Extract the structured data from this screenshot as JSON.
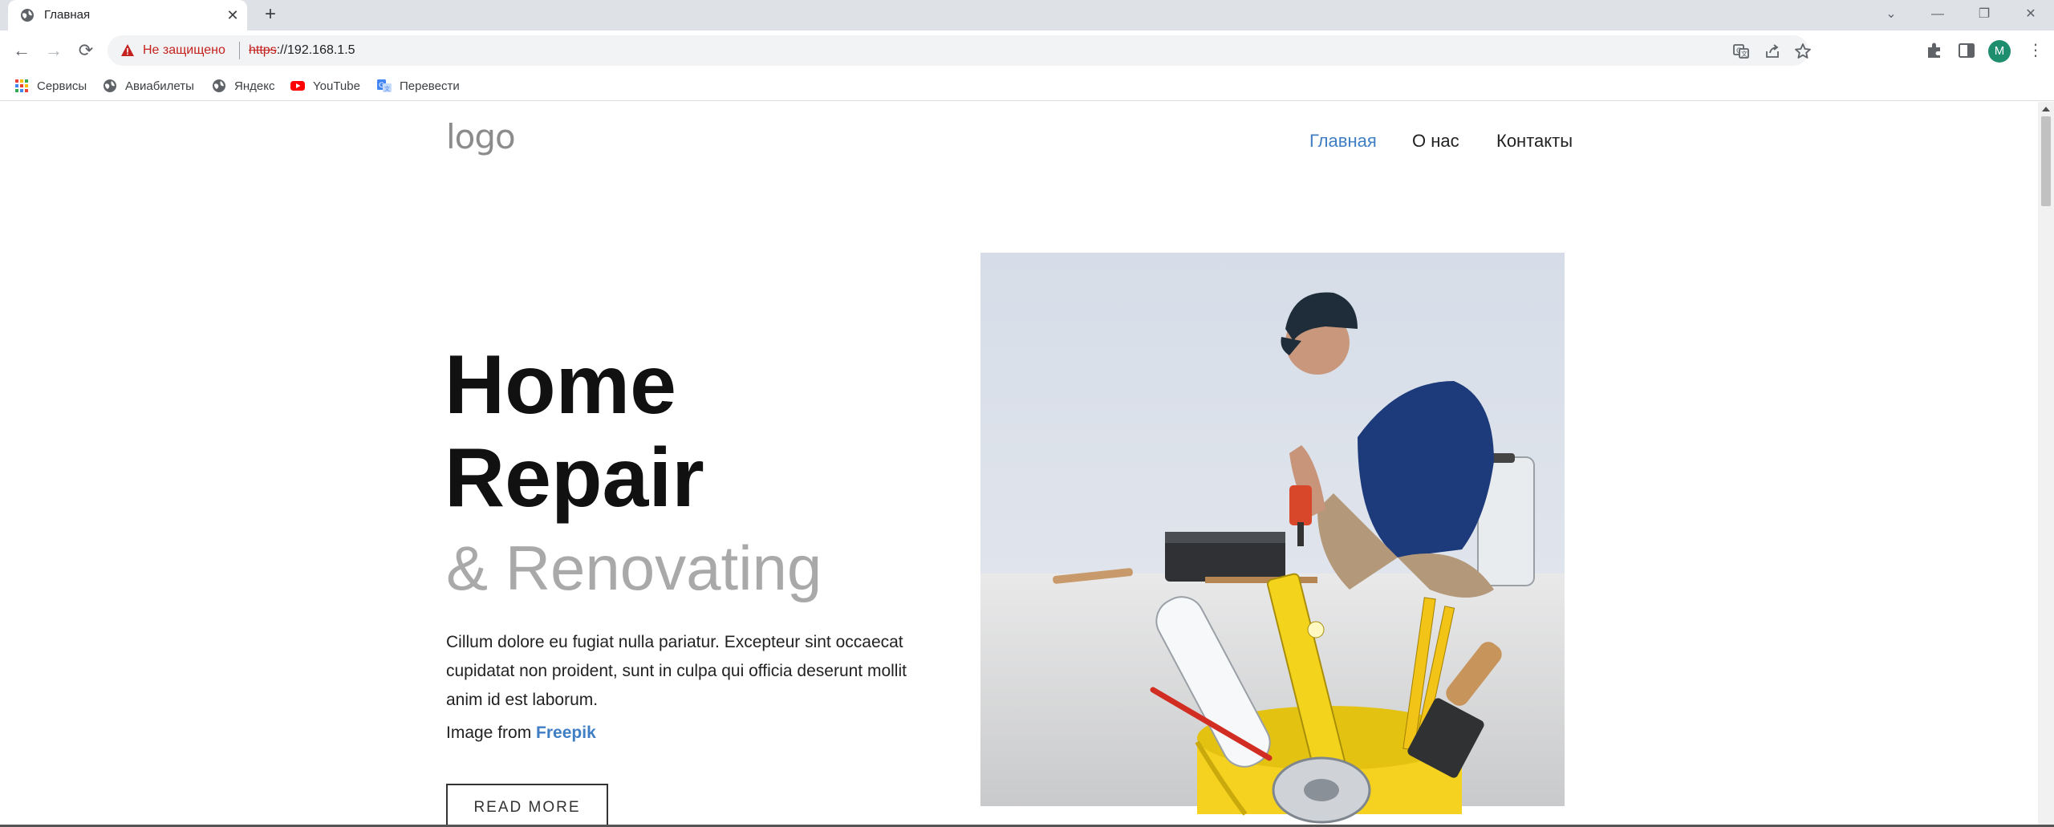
{
  "browser": {
    "tab": {
      "title": "Главная",
      "favicon": "globe-icon",
      "close_glyph": "✕"
    },
    "new_tab_glyph": "+",
    "window_controls": {
      "tab_search": "⌄",
      "minimize": "—",
      "restore": "❐",
      "close": "✕"
    },
    "toolbar": {
      "back": "←",
      "forward": "→",
      "reload": "⟳",
      "security_label": "Не защищено",
      "url_scheme": "https",
      "url_rest": "://192.168.1.5",
      "profile_initial": "M",
      "menu_glyph": "⋮"
    },
    "bookmarks": [
      {
        "label": "Сервисы",
        "icon": "apps-grid-icon"
      },
      {
        "label": "Авиабилеты",
        "icon": "globe-icon"
      },
      {
        "label": "Яндекс",
        "icon": "globe-icon"
      },
      {
        "label": "YouTube",
        "icon": "youtube-icon"
      },
      {
        "label": "Перевести",
        "icon": "translate-icon"
      }
    ]
  },
  "site": {
    "logo": "logo",
    "nav": [
      {
        "label": "Главная",
        "active": true
      },
      {
        "label": "О нас",
        "active": false
      },
      {
        "label": "Контакты",
        "active": false
      }
    ],
    "hero": {
      "title_line1": "Home",
      "title_line2": "Repair",
      "subtitle": "& Renovating",
      "lead": "Cillum dolore eu fugiat nulla pariatur. Excepteur sint occaecat cupidatat non proident, sunt in culpa qui officia deserunt mollit anim id est laborum.",
      "credit_prefix": "Image from ",
      "credit_link": "Freepik",
      "button": "READ MORE"
    }
  },
  "colors": {
    "accent": "#3f7ec4",
    "subtitle_gray": "#a9a9a9",
    "insecure_red": "#c5221f"
  }
}
